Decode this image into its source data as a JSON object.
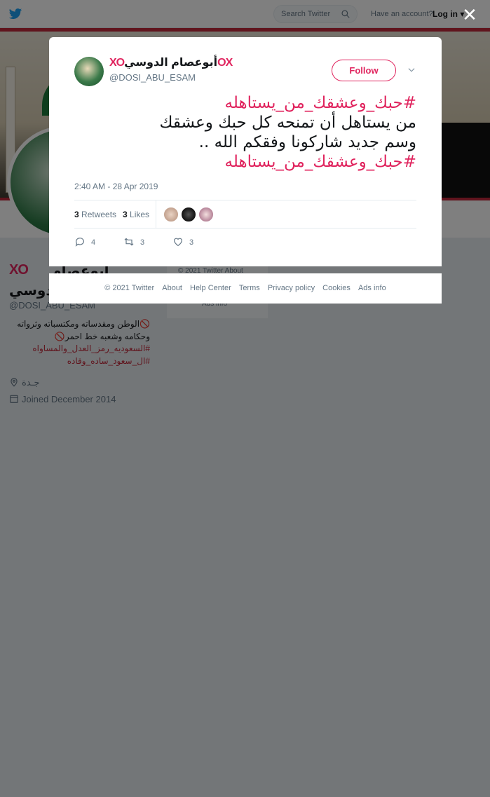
{
  "topbar": {
    "search_placeholder": "Search Twitter",
    "have_account": "Have an account?",
    "login_label": "Log in"
  },
  "profile": {
    "name_prefix_decoration": "XO",
    "name_line1": "أبوعصام",
    "name_line2": "الدوسي",
    "handle": "@DOSI_ABU_ESAM",
    "bio_line1": "الوطن ومقدساته ومكتسباته وثرواته",
    "bio_line2": "وحكامه وشعبه خط احمر",
    "bio_hashtag1": "#السعوديه_رمز_العدل_والمساواه",
    "bio_hashtag2": "#ال_سعود_ساده_وقاده",
    "location": "جـدة",
    "joined": "Joined December 2014"
  },
  "side_card": {
    "line1": "© 2021 Twitter   About",
    "line2": "Ads info"
  },
  "close_label": "✕",
  "tweet": {
    "author_name": "أبوعصام الدوسي",
    "author_decoration_left": "XO",
    "author_decoration_right": "OX",
    "author_handle": "@DOSI_ABU_ESAM",
    "follow_label": "Follow",
    "hashtag_top": "#حبك_وعشقك_من_يستاهله",
    "text_line1": "من يستاهل أن تمنحه كل حبك وعشقك",
    "text_line2": "وسم جديد شاركونا وفقكم الله ..",
    "hashtag_bottom": "#حبك_وعشقك_من_يستاهله",
    "timestamp": "2:40 AM - 28 Apr 2019",
    "retweets_count": "3",
    "retweets_label": "Retweets",
    "likes_count": "3",
    "likes_label": "Likes",
    "reply_count": "4",
    "retweet_action_count": "3",
    "like_action_count": "3"
  },
  "footer": {
    "copyright": "© 2021 Twitter",
    "about": "About",
    "help": "Help Center",
    "terms": "Terms",
    "privacy": "Privacy policy",
    "cookies": "Cookies",
    "ads": "Ads info"
  },
  "colors": {
    "accent": "#e0245e",
    "banner_stripe": "#c0293a",
    "twitter_blue": "#1da1f2"
  }
}
